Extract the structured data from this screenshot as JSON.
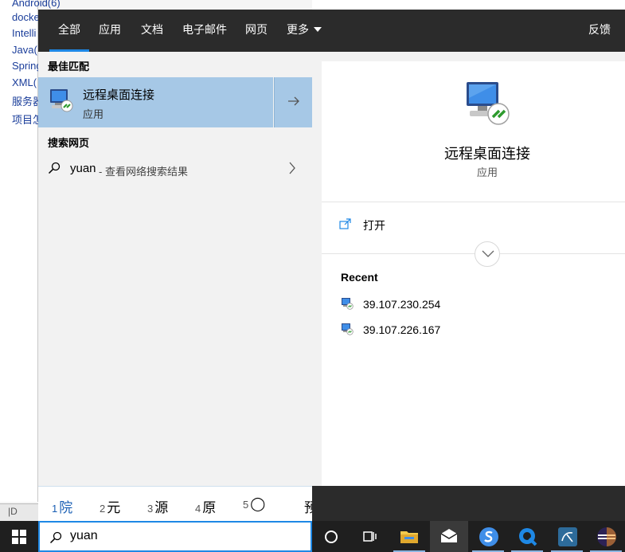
{
  "background": {
    "sidebar_links": [
      "Android(6)",
      "docke",
      "Intelli",
      "Java(",
      "Spring",
      "XML(",
      "服务器",
      "项目怎"
    ],
    "bottom_strip_text": "|D"
  },
  "nav": {
    "tabs": [
      {
        "label": "全部",
        "active": true
      },
      {
        "label": "应用",
        "active": false
      },
      {
        "label": "文档",
        "active": false
      },
      {
        "label": "电子邮件",
        "active": false
      },
      {
        "label": "网页",
        "active": false
      },
      {
        "label": "更多",
        "active": false
      }
    ],
    "feedback": "反馈"
  },
  "results": {
    "best_match_title": "最佳匹配",
    "best_match": {
      "name": "远程桌面连接",
      "type": "应用",
      "icon": "remote-desktop-icon"
    },
    "web_title": "搜索网页",
    "web_item": {
      "query": "yuan",
      "suffix": "- 查看网络搜索结果"
    }
  },
  "preview": {
    "name": "远程桌面连接",
    "type": "应用",
    "open_label": "打开",
    "recent_title": "Recent",
    "recent_items": [
      "39.107.230.254",
      "39.107.226.167"
    ]
  },
  "ime": {
    "candidates": [
      {
        "num": "1",
        "text": "院"
      },
      {
        "num": "2",
        "text": "元"
      },
      {
        "num": "3",
        "text": "源"
      },
      {
        "num": "4",
        "text": "原"
      },
      {
        "num": "5",
        "text": "◯"
      },
      {
        "num": "",
        "text": "预"
      }
    ]
  },
  "search": {
    "value": "yuan"
  },
  "colors": {
    "nav_bg": "#2b2b2b",
    "selection": "#a6c8e6",
    "accent": "#1e88e5",
    "taskbar": "#1f1f1f"
  },
  "taskbar_icons": [
    "windows-logo-icon",
    "cortana-icon",
    "task-view-icon",
    "file-explorer-icon",
    "mail-icon",
    "sogou-icon",
    "quark-icon",
    "mysql-workbench-icon",
    "eclipse-icon"
  ]
}
